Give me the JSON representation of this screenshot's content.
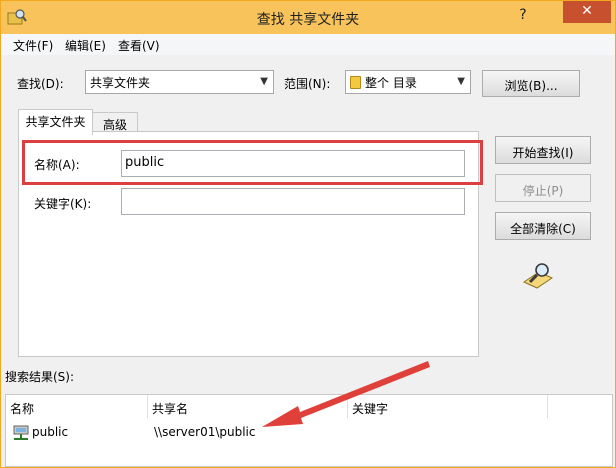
{
  "window": {
    "title": "查找 共享文件夹",
    "help_glyph": "?",
    "close_glyph": "✕"
  },
  "menu": {
    "items": [
      "文件(F)",
      "编辑(E)",
      "查看(V)"
    ]
  },
  "search": {
    "find_label": "查找(D):",
    "find_value": "共享文件夹",
    "scope_label": "范围(N):",
    "scope_value": "整个 目录",
    "browse_label": "浏览(B)..."
  },
  "tabs": [
    "共享文件夹",
    "高级"
  ],
  "form": {
    "name_label": "名称(A):",
    "name_value": "public",
    "keywords_label": "关键字(K):",
    "keywords_value": ""
  },
  "actions": {
    "start": "开始查找(I)",
    "stop": "停止(P)",
    "clear": "全部清除(C)"
  },
  "results": {
    "label": "搜索结果(S):",
    "columns": [
      "名称",
      "共享名",
      "关键字"
    ],
    "rows": [
      {
        "name": "public",
        "share": "\\\\server01\\public",
        "keywords": ""
      }
    ]
  },
  "colors": {
    "titlebar": "#f7c35a",
    "close": "#c7502e",
    "highlight": "#dc3f3f",
    "annotation_arrow": "#e0403a"
  },
  "icons": {
    "app": "find-folder-icon",
    "dropdown": "chevron-down-icon",
    "scope": "directory-icon",
    "search": "magnifier-icon",
    "result": "network-share-icon"
  }
}
